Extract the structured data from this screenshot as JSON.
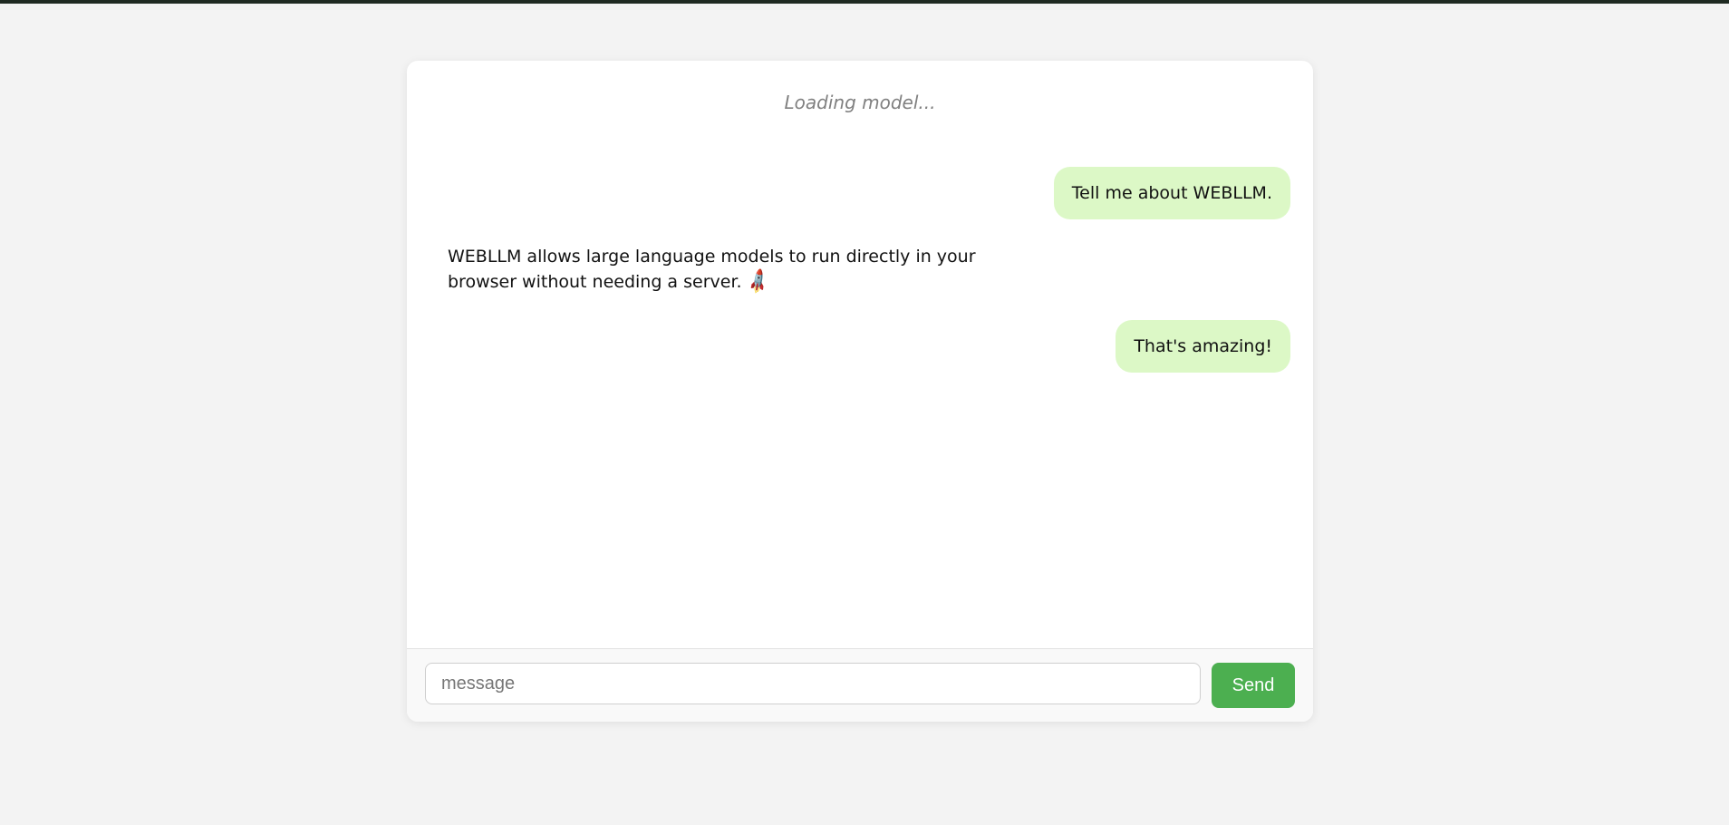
{
  "status": {
    "text": "Loading model..."
  },
  "conversation": {
    "messages": [
      {
        "role": "user",
        "text": "Tell me about WEBLLM."
      },
      {
        "role": "assistant",
        "text": "WEBLLM allows large language models to run directly in your browser without needing a server.",
        "emoji": "🚀"
      },
      {
        "role": "user",
        "text": "That's amazing!"
      }
    ]
  },
  "composer": {
    "placeholder": "message",
    "value": "",
    "send_label": "Send"
  },
  "colors": {
    "user_bubble": "#dcf8c6",
    "send_button": "#4caf50",
    "background": "#f3f3f3"
  }
}
